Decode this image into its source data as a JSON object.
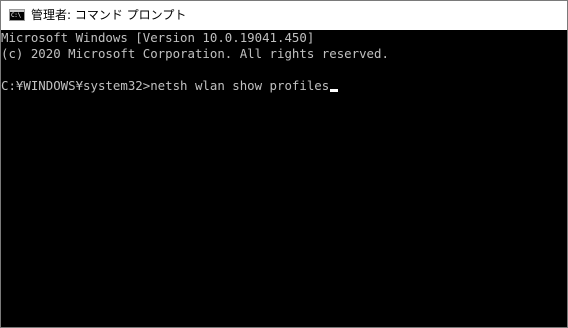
{
  "window": {
    "title": "管理者: コマンド プロンプト",
    "icon": "command-prompt-icon",
    "icon_glyph": "C:\\"
  },
  "console": {
    "text_color": "#c0c0c0",
    "background_color": "#000000",
    "lines": [
      "Microsoft Windows [Version 10.0.19041.450]",
      "(c) 2020 Microsoft Corporation. All rights reserved.",
      "",
      "C:¥WINDOWS¥system32>netsh wlan show profiles"
    ]
  }
}
